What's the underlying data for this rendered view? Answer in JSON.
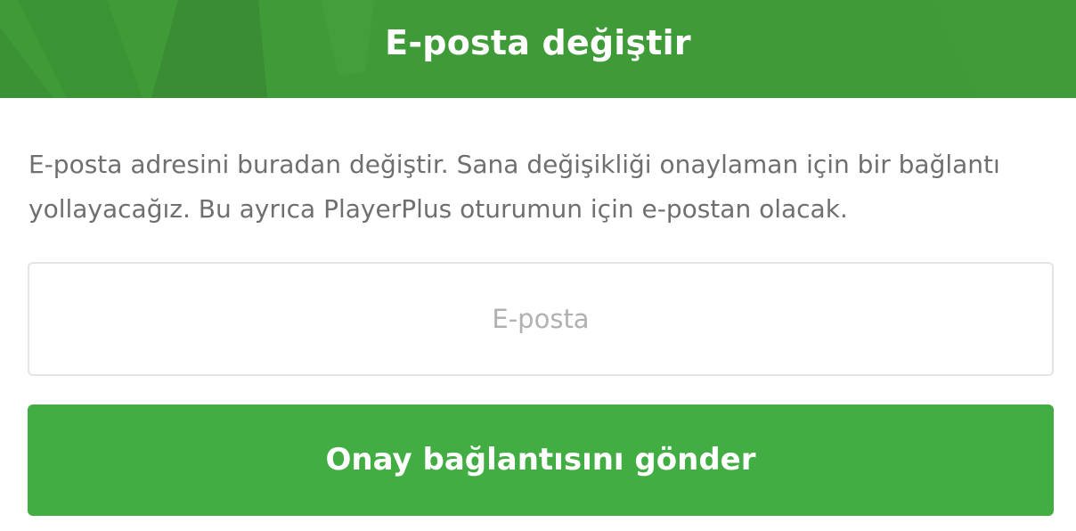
{
  "header": {
    "title": "E-posta değiştir",
    "background_color": "#3f9a38"
  },
  "description": "E-posta adresini buradan değiştir. Sana değişikliği onaylaman için bir bağlantı yollayacağız. Bu ayrıca PlayerPlus oturumun için e-postan olacak.",
  "email_field": {
    "value": "",
    "placeholder": "E-posta"
  },
  "submit_button": {
    "label": "Onay bağlantısını gönder",
    "color": "#41ad42"
  }
}
